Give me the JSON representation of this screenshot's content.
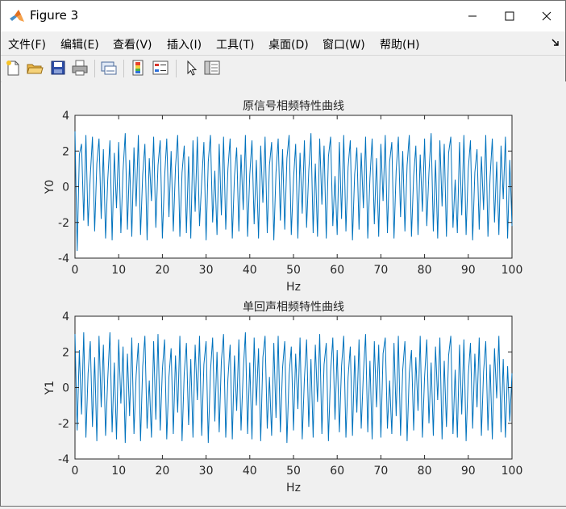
{
  "window": {
    "title": "Figure 3",
    "controls": {
      "minimize": "—",
      "maximize": "☐",
      "close": "✕"
    }
  },
  "menu": {
    "items": [
      "文件(F)",
      "编辑(E)",
      "查看(V)",
      "插入(I)",
      "工具(T)",
      "桌面(D)",
      "窗口(W)",
      "帮助(H)"
    ]
  },
  "toolbar": {
    "buttons": [
      "new-figure-icon",
      "open-file-icon",
      "save-icon",
      "print-icon",
      "link-plot-icon",
      "colorbar-icon",
      "legend-icon",
      "pointer-icon",
      "property-inspector-icon"
    ]
  },
  "colors": {
    "line": "#0072bd",
    "axes_bg": "#ffffff",
    "figure_bg": "#f0f0f0"
  },
  "chart_data": [
    {
      "type": "line",
      "title": "原信号相频特性曲线",
      "xlabel": "Hz",
      "ylabel": "Y0",
      "xlim": [
        0,
        100
      ],
      "ylim": [
        -4,
        4
      ],
      "xticks": [
        0,
        10,
        20,
        30,
        40,
        50,
        60,
        70,
        80,
        90,
        100
      ],
      "yticks": [
        -4,
        -2,
        0,
        2,
        4
      ],
      "grid": false,
      "x": [
        0,
        0.5,
        1,
        1.5,
        2,
        2.5,
        3,
        3.5,
        4,
        4.5,
        5,
        5.5,
        6,
        6.5,
        7,
        7.5,
        8,
        8.5,
        9,
        9.5,
        10,
        10.5,
        11,
        11.5,
        12,
        12.5,
        13,
        13.5,
        14,
        14.5,
        15,
        15.5,
        16,
        16.5,
        17,
        17.5,
        18,
        18.5,
        19,
        19.5,
        20,
        20.5,
        21,
        21.5,
        22,
        22.5,
        23,
        23.5,
        24,
        24.5,
        25,
        25.5,
        26,
        26.5,
        27,
        27.5,
        28,
        28.5,
        29,
        29.5,
        30,
        30.5,
        31,
        31.5,
        32,
        32.5,
        33,
        33.5,
        34,
        34.5,
        35,
        35.5,
        36,
        36.5,
        37,
        37.5,
        38,
        38.5,
        39,
        39.5,
        40,
        40.5,
        41,
        41.5,
        42,
        42.5,
        43,
        43.5,
        44,
        44.5,
        45,
        45.5,
        46,
        46.5,
        47,
        47.5,
        48,
        48.5,
        49,
        49.5,
        50,
        50.5,
        51,
        51.5,
        52,
        52.5,
        53,
        53.5,
        54,
        54.5,
        55,
        55.5,
        56,
        56.5,
        57,
        57.5,
        58,
        58.5,
        59,
        59.5,
        60,
        60.5,
        61,
        61.5,
        62,
        62.5,
        63,
        63.5,
        64,
        64.5,
        65,
        65.5,
        66,
        66.5,
        67,
        67.5,
        68,
        68.5,
        69,
        69.5,
        70,
        70.5,
        71,
        71.5,
        72,
        72.5,
        73,
        73.5,
        74,
        74.5,
        75,
        75.5,
        76,
        76.5,
        77,
        77.5,
        78,
        78.5,
        79,
        79.5,
        80,
        80.5,
        81,
        81.5,
        82,
        82.5,
        83,
        83.5,
        84,
        84.5,
        85,
        85.5,
        86,
        86.5,
        87,
        87.5,
        88,
        88.5,
        89,
        89.5,
        90,
        90.5,
        91,
        91.5,
        92,
        92.5,
        93,
        93.5,
        94,
        94.5,
        95,
        95.5,
        96,
        96.5,
        97,
        97.5,
        98,
        98.5,
        99,
        99.5,
        100
      ],
      "values": [
        3.1,
        -3.6,
        1.8,
        2.4,
        -1.9,
        2.9,
        -2.2,
        0.6,
        2.8,
        -2.5,
        1.3,
        2.7,
        -1.8,
        2.1,
        -2.9,
        0.4,
        2.6,
        -3.0,
        1.9,
        -1.2,
        2.5,
        -2.6,
        0.9,
        3.0,
        -2.4,
        1.5,
        -2.8,
        2.2,
        -1.1,
        2.9,
        -2.7,
        0.7,
        2.4,
        -3.0,
        1.6,
        -0.8,
        2.8,
        -2.3,
        1.2,
        2.6,
        -2.9,
        0.5,
        2.7,
        -1.7,
        2.0,
        -2.5,
        1.1,
        2.9,
        -2.8,
        0.8,
        2.3,
        -2.6,
        1.7,
        -2.9,
        2.6,
        -1.4,
        2.8,
        -2.2,
        0.3,
        2.5,
        -3.0,
        1.4,
        2.9,
        -2.0,
        0.9,
        -2.7,
        2.4,
        -1.6,
        2.8,
        -2.4,
        1.0,
        2.7,
        -2.9,
        0.6,
        2.2,
        -2.5,
        1.8,
        -1.3,
        2.9,
        -2.8,
        0.7,
        2.6,
        -2.1,
        1.5,
        -2.9,
        2.3,
        -0.9,
        2.8,
        -2.6,
        1.2,
        2.5,
        -3.0,
        0.8,
        2.7,
        -1.9,
        2.1,
        -2.4,
        1.6,
        2.9,
        -2.7,
        0.4,
        2.4,
        -2.9,
        1.9,
        -1.5,
        2.6,
        -2.3,
        0.9,
        3.0,
        -2.6,
        1.3,
        -2.8,
        2.7,
        -1.0,
        2.3,
        -2.9,
        1.7,
        2.8,
        -2.2,
        0.6,
        -2.7,
        2.5,
        -1.8,
        2.9,
        -2.5,
        1.1,
        2.6,
        -3.0,
        0.7,
        2.2,
        -2.4,
        1.9,
        -1.2,
        2.8,
        -2.9,
        0.5,
        2.7,
        -2.1,
        1.6,
        -2.8,
        2.4,
        -0.8,
        2.9,
        -2.6,
        1.4,
        2.5,
        -2.9,
        0.9,
        2.8,
        -1.7,
        2.0,
        -2.5,
        1.2,
        2.9,
        -2.8,
        0.6,
        2.3,
        -2.7,
        1.8,
        -1.4,
        2.7,
        -2.2,
        0.8,
        3.0,
        -2.5,
        1.5,
        -2.9,
        2.6,
        -1.1,
        2.4,
        -2.8,
        1.9,
        2.8,
        -2.3,
        0.4,
        -2.6,
        2.5,
        -1.6,
        2.9,
        -2.7,
        1.0,
        2.6,
        -3.0,
        0.8,
        2.1,
        -2.4,
        1.7,
        -1.3,
        2.9,
        -2.8,
        0.6,
        2.7,
        -2.0,
        1.4,
        -2.7,
        2.3,
        -0.7,
        2.8,
        -2.9,
        1.5,
        -2.2,
        1.8
      ],
      "series": [
        {
          "values_ref": "values"
        }
      ]
    },
    {
      "type": "line",
      "title": "单回声相频特性曲线",
      "xlabel": "Hz",
      "ylabel": "Y1",
      "xlim": [
        0,
        100
      ],
      "ylim": [
        -4,
        4
      ],
      "xticks": [
        0,
        10,
        20,
        30,
        40,
        50,
        60,
        70,
        80,
        90,
        100
      ],
      "yticks": [
        -4,
        -2,
        0,
        2,
        4
      ],
      "grid": false,
      "x": [
        0,
        0.5,
        1,
        1.5,
        2,
        2.5,
        3,
        3.5,
        4,
        4.5,
        5,
        5.5,
        6,
        6.5,
        7,
        7.5,
        8,
        8.5,
        9,
        9.5,
        10,
        10.5,
        11,
        11.5,
        12,
        12.5,
        13,
        13.5,
        14,
        14.5,
        15,
        15.5,
        16,
        16.5,
        17,
        17.5,
        18,
        18.5,
        19,
        19.5,
        20,
        20.5,
        21,
        21.5,
        22,
        22.5,
        23,
        23.5,
        24,
        24.5,
        25,
        25.5,
        26,
        26.5,
        27,
        27.5,
        28,
        28.5,
        29,
        29.5,
        30,
        30.5,
        31,
        31.5,
        32,
        32.5,
        33,
        33.5,
        34,
        34.5,
        35,
        35.5,
        36,
        36.5,
        37,
        37.5,
        38,
        38.5,
        39,
        39.5,
        40,
        40.5,
        41,
        41.5,
        42,
        42.5,
        43,
        43.5,
        44,
        44.5,
        45,
        45.5,
        46,
        46.5,
        47,
        47.5,
        48,
        48.5,
        49,
        49.5,
        50,
        50.5,
        51,
        51.5,
        52,
        52.5,
        53,
        53.5,
        54,
        54.5,
        55,
        55.5,
        56,
        56.5,
        57,
        57.5,
        58,
        58.5,
        59,
        59.5,
        60,
        60.5,
        61,
        61.5,
        62,
        62.5,
        63,
        63.5,
        64,
        64.5,
        65,
        65.5,
        66,
        66.5,
        67,
        67.5,
        68,
        68.5,
        69,
        69.5,
        70,
        70.5,
        71,
        71.5,
        72,
        72.5,
        73,
        73.5,
        74,
        74.5,
        75,
        75.5,
        76,
        76.5,
        77,
        77.5,
        78,
        78.5,
        79,
        79.5,
        80,
        80.5,
        81,
        81.5,
        82,
        82.5,
        83,
        83.5,
        84,
        84.5,
        85,
        85.5,
        86,
        86.5,
        87,
        87.5,
        88,
        88.5,
        89,
        89.5,
        90,
        90.5,
        91,
        91.5,
        92,
        92.5,
        93,
        93.5,
        94,
        94.5,
        95,
        95.5,
        96,
        96.5,
        97,
        97.5,
        98,
        98.5,
        99,
        99.5,
        100
      ],
      "values": [
        3.0,
        -2.4,
        2.1,
        -1.5,
        3.1,
        -2.8,
        0.8,
        2.6,
        -2.2,
        1.7,
        -3.0,
        2.9,
        -1.1,
        2.4,
        -2.7,
        0.5,
        3.1,
        -2.5,
        1.4,
        -2.9,
        2.7,
        -0.9,
        2.3,
        -3.1,
        1.9,
        -1.6,
        2.8,
        -2.6,
        0.7,
        2.5,
        -3.0,
        1.2,
        2.9,
        -2.3,
        0.4,
        -2.8,
        2.6,
        -1.8,
        3.0,
        -2.4,
        1.0,
        2.7,
        -2.9,
        0.6,
        2.2,
        -2.6,
        1.8,
        -1.4,
        2.9,
        -3.0,
        0.8,
        2.5,
        -2.1,
        1.6,
        -2.8,
        2.4,
        -0.7,
        2.9,
        -2.7,
        1.3,
        2.6,
        -3.1,
        0.9,
        2.8,
        -1.9,
        2.0,
        -2.5,
        1.5,
        3.0,
        -2.8,
        0.5,
        2.4,
        -2.9,
        1.8,
        -1.3,
        2.7,
        -2.4,
        0.9,
        3.1,
        -2.6,
        1.4,
        -2.9,
        2.8,
        -1.0,
        2.2,
        -3.0,
        1.7,
        2.9,
        -2.3,
        0.6,
        -2.7,
        2.5,
        -1.7,
        2.9,
        -2.5,
        1.1,
        2.6,
        -3.1,
        0.7,
        2.3,
        -2.4,
        1.9,
        -1.2,
        2.8,
        -2.9,
        0.5,
        2.7,
        -2.2,
        1.6,
        -2.8,
        2.4,
        -0.8,
        3.0,
        -2.6,
        1.3,
        2.5,
        -3.0,
        0.9,
        2.8,
        -1.8,
        2.1,
        -2.5,
        1.2,
        2.9,
        -2.8,
        0.6,
        2.3,
        -2.7,
        1.8,
        -1.4,
        2.7,
        -2.3,
        0.8,
        3.0,
        -2.5,
        1.5,
        -2.9,
        2.6,
        -1.1,
        2.4,
        -2.8,
        1.9,
        2.8,
        -2.3,
        0.4,
        -2.6,
        2.5,
        -1.6,
        2.9,
        -2.7,
        1.0,
        2.6,
        -3.0,
        0.8,
        2.1,
        -2.4,
        1.7,
        -1.3,
        2.9,
        -2.8,
        0.6,
        2.7,
        -2.0,
        1.4,
        -2.7,
        2.3,
        -0.7,
        2.8,
        -2.9,
        1.5,
        -2.2,
        1.8,
        2.9,
        -2.6,
        1.0,
        -2.8,
        2.4,
        -1.5,
        2.7,
        -3.0,
        0.7,
        2.5,
        -2.3,
        1.9,
        -1.1,
        2.8,
        -2.7,
        0.9,
        2.6,
        -2.4,
        1.3,
        -2.9,
        2.2,
        -0.6,
        2.9,
        -2.5,
        1.6,
        -2.8,
        1.2,
        -1.9,
        0.8
      ],
      "series": [
        {
          "values_ref": "values"
        }
      ]
    }
  ]
}
